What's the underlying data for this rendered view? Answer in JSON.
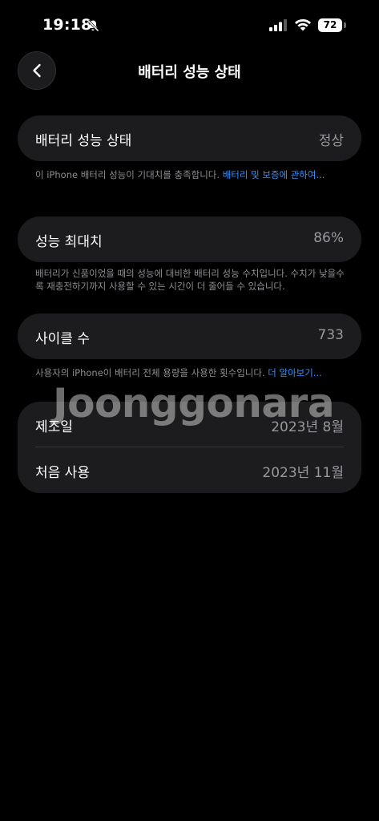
{
  "status_bar": {
    "time": "19:18",
    "battery_level": "72",
    "icons": [
      "bell-slash-icon",
      "cellular-signal-icon",
      "wifi-icon",
      "battery-icon"
    ]
  },
  "header": {
    "title": "배터리 성능 상태",
    "back_icon": "chevron-left-icon"
  },
  "battery_health": {
    "label": "배터리 성능 상태",
    "value": "정상",
    "footnote_text": "이 iPhone 배터리 성능이 기대치를 충족합니다. ",
    "footnote_link": "배터리 및 보증에 관하여..."
  },
  "max_capacity": {
    "label": "성능 최대치",
    "value": "86%",
    "footnote": "배터리가 신품이었을 때의 성능에 대비한 배터리 성능 수치입니다. 수치가 낮을수록 재충전하기까지 사용할 수 있는 시간이 더 줄어들 수 있습니다."
  },
  "cycle_count": {
    "label": "사이클 수",
    "value": "733",
    "footnote_text": "사용자의 iPhone이 배터리 전체 용량을 사용한 횟수입니다. ",
    "footnote_link": "더 알아보기..."
  },
  "dates": {
    "manufacture_label": "제조일",
    "manufacture_value": "2023년 8월",
    "first_use_label": "처음 사용",
    "first_use_value": "2023년 11월"
  },
  "watermark": "Joonggonara",
  "colors": {
    "background": "#000000",
    "card": "#1c1c1e",
    "secondary_text": "#98989e",
    "link": "#3a8ef6"
  }
}
